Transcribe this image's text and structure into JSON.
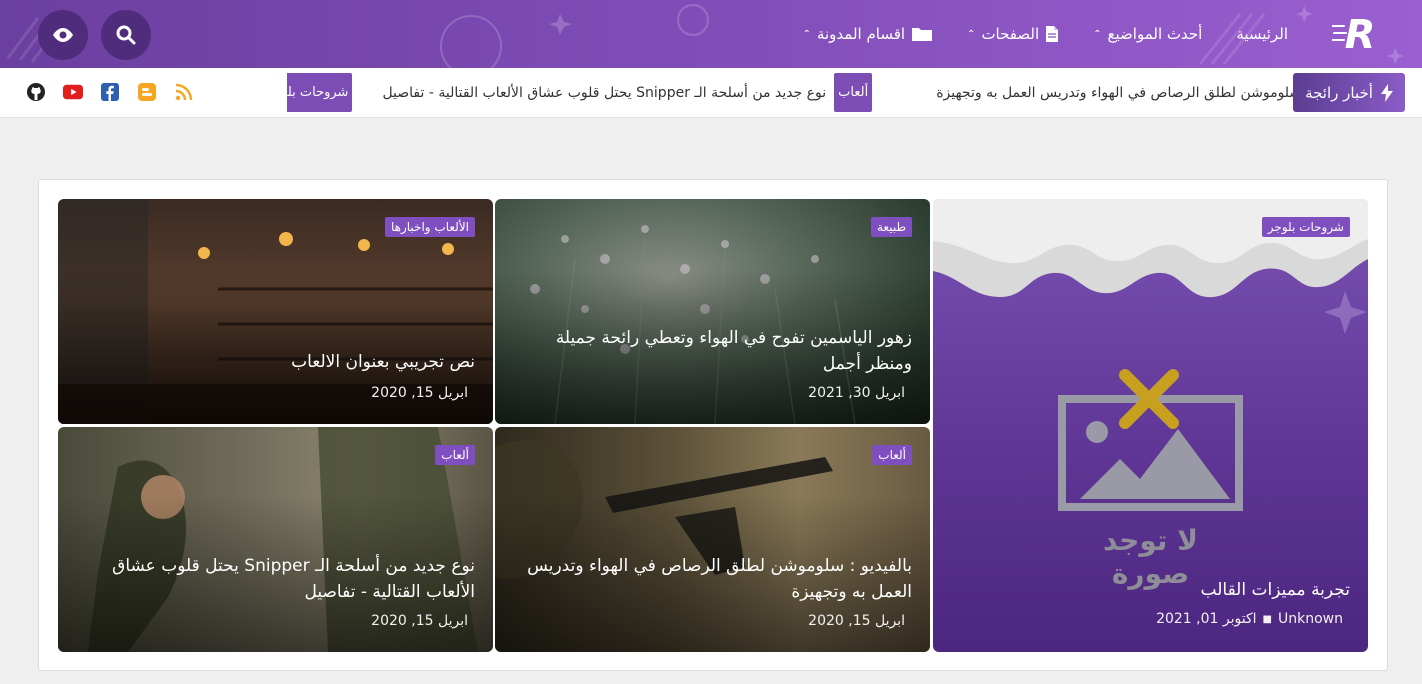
{
  "header": {
    "nav": [
      {
        "label": "الرئيسية",
        "has_menu": false,
        "icon": ""
      },
      {
        "label": "أحدث المواضيع",
        "has_menu": true,
        "icon": ""
      },
      {
        "label": "الصفحات",
        "has_menu": true,
        "icon": "file-icon"
      },
      {
        "label": "اقسام المدونة",
        "has_menu": true,
        "icon": "folder-icon"
      }
    ],
    "chevron": "⌃",
    "logo_letter": "R",
    "colors": {
      "bar_start": "#6b3fa0",
      "bar_end": "#9a5fd0",
      "button_bg": "#4f2c7c"
    }
  },
  "ticker": {
    "label": "أخبار رائجة",
    "items": [
      {
        "text": "بالفيديو : سلوموشن لطلق الرصاص في الهواء وتدريس العمل به وتجهيزة",
        "tag": "ألعاب"
      },
      {
        "text": "نوع جديد من أسلحة الـ Snipper يحتل قلوب عشاق الألعاب القتالية - تفاصيل",
        "tag": "شروحات بلوجر"
      }
    ],
    "social": [
      "rss-icon",
      "blogger-icon",
      "facebook-icon",
      "youtube-icon",
      "github-icon"
    ]
  },
  "cards": [
    {
      "badge": "شروحات بلوجر",
      "title": "تجربة مميزات القالب",
      "author": "Unknown",
      "date": "اكتوبر 01, 2021",
      "no_image_text": "لا توجد صورة"
    },
    {
      "badge": "طبيعة",
      "title": "زهور الياسمين تفوح في الهواء وتعطي رائحة جميلة ومنظر أجمل",
      "date": "ابريل 30, 2021"
    },
    {
      "badge": "الألعاب واخبارها",
      "title": "نص تجريبي بعنوان الالعاب",
      "date": "ابريل 15, 2020"
    },
    {
      "badge": "ألعاب",
      "title": "بالفيديو : سلوموشن لطلق الرصاص في الهواء وتدريس العمل به وتجهيزة",
      "date": "ابريل 15, 2020"
    },
    {
      "badge": "ألعاب",
      "title": "نوع جديد من أسلحة الـ Snipper يحتل قلوب عشاق الألعاب القتالية - تفاصيل",
      "date": "ابريل 15, 2020"
    }
  ]
}
